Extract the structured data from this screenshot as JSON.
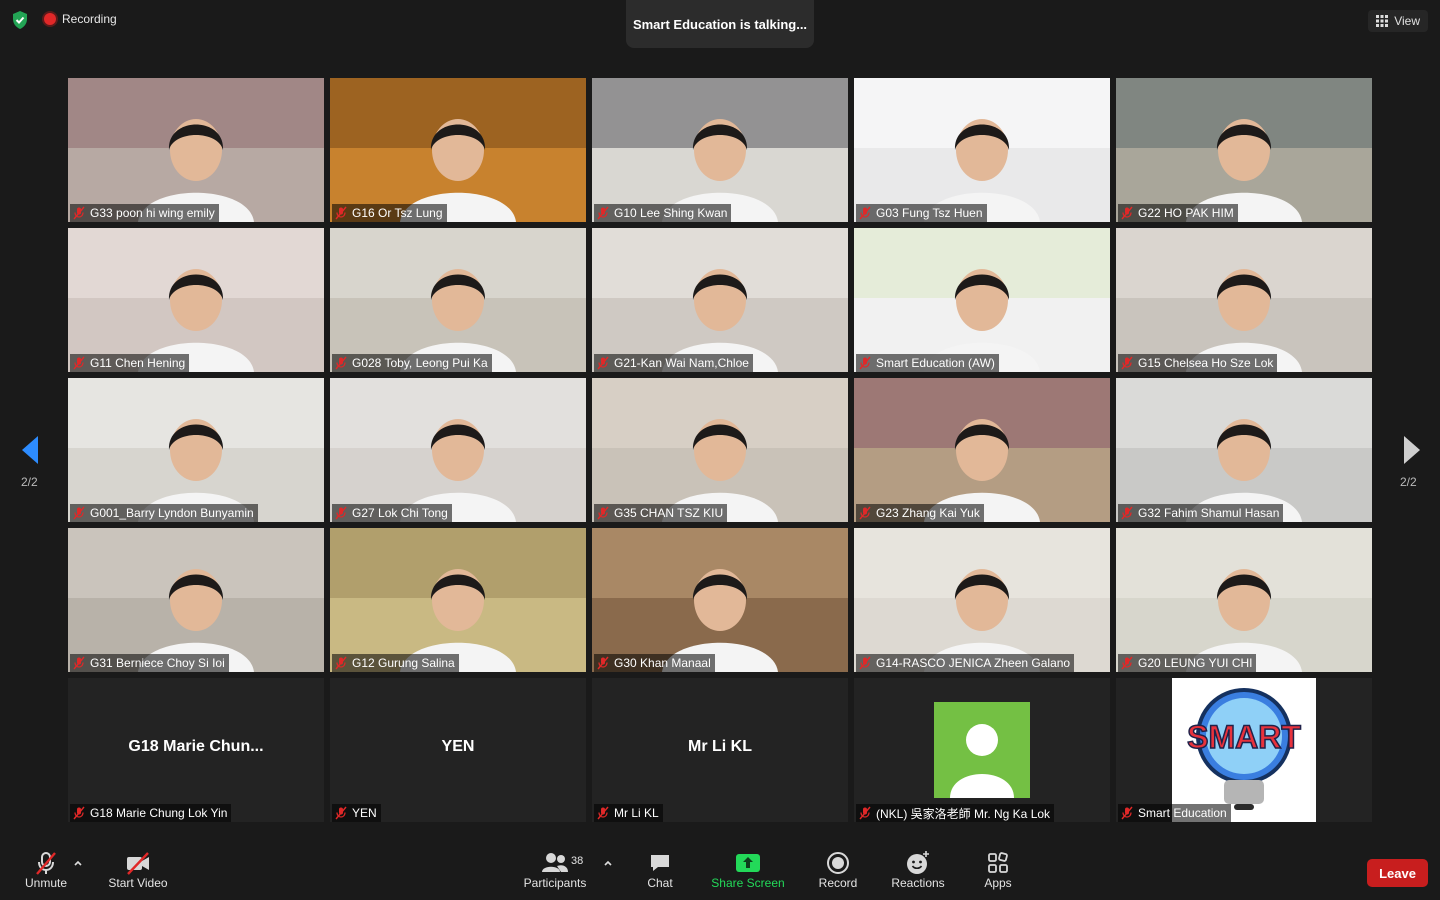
{
  "topbar": {
    "recording_label": "Recording",
    "talking_text": "Smart Education is talking...",
    "view_label": "View"
  },
  "pager": {
    "left": "2/2",
    "right": "2/2"
  },
  "tiles": [
    {
      "name": "G33 poon hi wing emily",
      "bg": "#b7a9a3",
      "wall": "#8f6b70"
    },
    {
      "name": "G16 Or Tsz Lung",
      "bg": "#c8822e",
      "wall": "#7a4a18"
    },
    {
      "name": "G10 Lee Shing Kwan",
      "bg": "#d9d7d2",
      "wall": "#5a5a5e"
    },
    {
      "name": "G03 Fung Tsz Huen",
      "bg": "#e9e9ea",
      "wall": "#ffffff"
    },
    {
      "name": "G22 HO PAK HIM",
      "bg": "#a9a69a",
      "wall": "#5f6c6d"
    },
    {
      "name": "G11 Chen Hening",
      "bg": "#d2c7c2",
      "wall": "#efe6e3"
    },
    {
      "name": "G028 Toby, Leong Pui Ka",
      "bg": "#c8c3b9",
      "wall": "#e6e3de"
    },
    {
      "name": "G21-Kan Wai Nam,Chloe",
      "bg": "#cfc9c3",
      "wall": "#f0ede9"
    },
    {
      "name": "Smart Education (AW)",
      "bg": "#f1f1f1",
      "wall": "#dbe7c5"
    },
    {
      "name": "G15 Chelsea Ho Sze Lok",
      "bg": "#c9c4bd",
      "wall": "#e8e4de"
    },
    {
      "name": "G001_Barry Lyndon Bunyamin",
      "bg": "#d7d5cf",
      "wall": "#f2f2f0"
    },
    {
      "name": "G27 Lok Chi Tong",
      "bg": "#d6d2ce",
      "wall": "#ecebea"
    },
    {
      "name": "G35 CHAN TSZ KIU",
      "bg": "#c9c2b8",
      "wall": "#e2dad0"
    },
    {
      "name": "G23 Zhang Kai Yuk",
      "bg": "#b49d83",
      "wall": "#8a5a6a"
    },
    {
      "name": "G32 Fahim Shamul Hasan",
      "bg": "#c9c9c7",
      "wall": "#e8e8e6"
    },
    {
      "name": "G31 Berniece Choy Si Ioi",
      "bg": "#b8b2a9",
      "wall": "#d9d4cc"
    },
    {
      "name": "G12 Gurung Salina",
      "bg": "#c9b983",
      "wall": "#9c8a5a"
    },
    {
      "name": "G30 Khan Manaal",
      "bg": "#8a6a4c",
      "wall": "#c3a07a"
    },
    {
      "name": "G14-RASCO JENICA Zheen Galano",
      "bg": "#ddd9d2",
      "wall": "#efece6"
    },
    {
      "name": "G20 LEUNG YUI CHI",
      "bg": "#d7d6cc",
      "wall": "#ecebe4"
    },
    {
      "name": "G18 Marie Chung Lok Yin",
      "display": "G18 Marie Chun...",
      "mode": "text"
    },
    {
      "name": "YEN",
      "display": "YEN",
      "mode": "text"
    },
    {
      "name": "Mr Li KL",
      "display": "Mr Li KL",
      "mode": "text"
    },
    {
      "name": "(NKL) 吳家洛老師 Mr. Ng Ka Lok",
      "mode": "avatar"
    },
    {
      "name": "Smart Education",
      "mode": "logo",
      "logo_text": "SMART"
    }
  ],
  "toolbar": {
    "unmute_label": "Unmute",
    "start_video_label": "Start Video",
    "participants_label": "Participants",
    "participants_count": "38",
    "chat_label": "Chat",
    "share_screen_label": "Share Screen",
    "record_label": "Record",
    "reactions_label": "Reactions",
    "apps_label": "Apps",
    "leave_label": "Leave"
  },
  "colors": {
    "accent_green": "#23d959",
    "leave_red": "#c81e1e",
    "mute_red": "#e02828",
    "nav_blue": "#2d8cff"
  }
}
